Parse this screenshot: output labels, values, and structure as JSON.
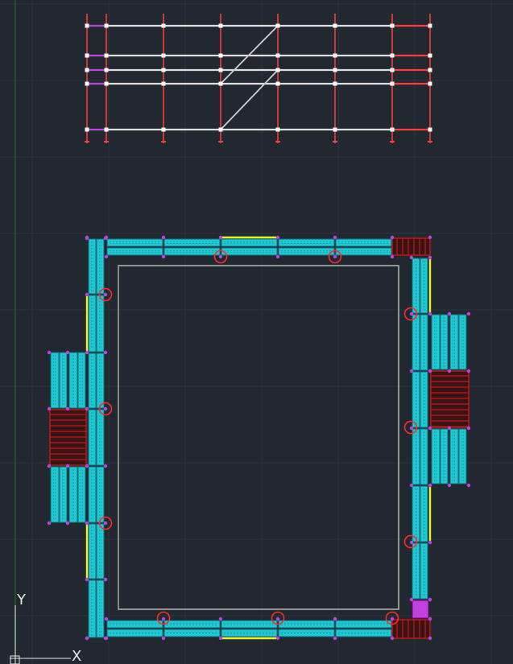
{
  "app": {
    "view": "2D Wireframe"
  },
  "colors": {
    "background": "#212830",
    "grid": "#2c3440",
    "y_axis_line": "#1f5a2a",
    "plank_fill": "#1fc8d2",
    "plank_dark": "#0f6f7a",
    "post": "#ff3b3b",
    "ledger": "#dedede",
    "brace": "#cfcfcf",
    "node": "#c040e0",
    "toeboard": "#f0f020",
    "tie_circle": "#ff2a2a",
    "stair": "#c01818",
    "outline": "#b8b8b8"
  },
  "icons": {
    "ucs": "ucs-axis-icon"
  },
  "ucs": {
    "x_label": "X",
    "y_label": "Y"
  }
}
